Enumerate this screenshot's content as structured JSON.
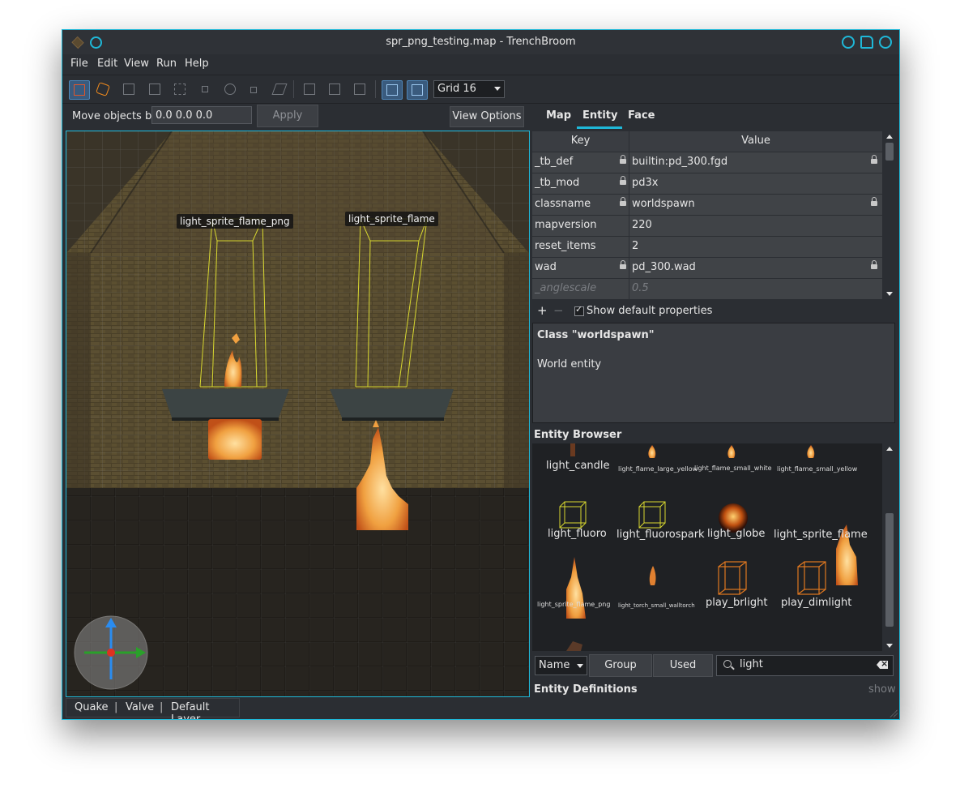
{
  "window": {
    "title": "spr_png_testing.map - TrenchBroom",
    "accent": "#1fb8d8"
  },
  "menu": [
    "File",
    "Edit",
    "View",
    "Run",
    "Help"
  ],
  "toolbar": {
    "tools": [
      "clip-tool-icon",
      "vertex-tool-icon",
      "edge-tool-icon",
      "face-tool-icon",
      "rotate-tool-icon",
      "scale-tool-icon",
      "shear-tool-icon",
      "duplicate-icon",
      "flip-horizontal-icon",
      "flip-vertical-icon",
      "texture-lock-icon",
      "uv-lock-icon"
    ],
    "grid": "Grid 16"
  },
  "move": {
    "label": "Move objects by",
    "value": "0.0 0.0 0.0",
    "apply": "Apply",
    "view_options": "View Options"
  },
  "viewport": {
    "labels": [
      "light_sprite_flame_png",
      "light_sprite_flame"
    ]
  },
  "status": {
    "game": "Quake",
    "format": "Valve",
    "layer": "Default Layer",
    "sep": "|"
  },
  "tabs": {
    "map": "Map",
    "entity": "Entity",
    "face": "Face"
  },
  "props": {
    "header_key": "Key",
    "header_value": "Value",
    "rows": [
      {
        "key": "_tb_def",
        "value": "builtin:pd_300.fgd"
      },
      {
        "key": "_tb_mod",
        "value": "pd3x"
      },
      {
        "key": "classname",
        "value": "worldspawn"
      },
      {
        "key": "mapversion",
        "value": "220"
      },
      {
        "key": "reset_items",
        "value": "2"
      },
      {
        "key": "wad",
        "value": "pd_300.wad"
      },
      {
        "key": "_anglescale",
        "value": "0.5"
      }
    ],
    "add": "+",
    "remove": "−",
    "show_default": "Show default properties"
  },
  "class_desc": {
    "title": "Class \"worldspawn\"",
    "text": "World entity"
  },
  "entity_browser": {
    "title": "Entity Browser",
    "items": [
      "light_candle",
      "light_flame_large_yellow",
      "light_flame_small_white",
      "light_flame_small_yellow",
      "light_fluoro",
      "light_fluorospark",
      "light_globe",
      "light_sprite_flame",
      "light_sprite_flame_png",
      "light_torch_small_walltorch",
      "play_brlight",
      "play_dimlight"
    ],
    "sort": "Name",
    "group": "Group",
    "used": "Used",
    "search": "light"
  },
  "entity_defs": {
    "title": "Entity Definitions",
    "show": "show"
  }
}
